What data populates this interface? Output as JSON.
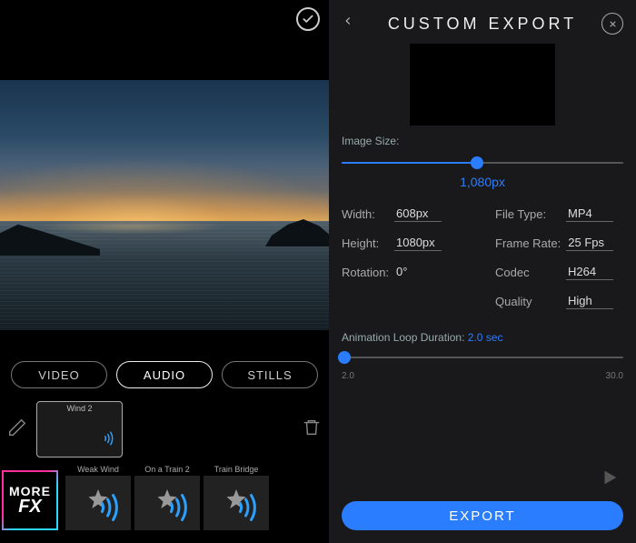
{
  "left": {
    "tabs": {
      "video": "VIDEO",
      "audio": "AUDIO",
      "stills": "STILLS"
    },
    "clip": {
      "label": "Wind 2"
    },
    "morefx": {
      "line1": "MORE",
      "line2": "FX"
    },
    "fx": [
      {
        "name": "Weak Wind"
      },
      {
        "name": "On a Train 2"
      },
      {
        "name": "Train Bridge"
      }
    ]
  },
  "right": {
    "title": "CUSTOM  EXPORT",
    "image_size_label": "Image Size:",
    "image_size_value": "1,080px",
    "image_size_pct": 48,
    "width_label": "Width:",
    "width_value": "608px",
    "height_label": "Height:",
    "height_value": "1080px",
    "rotation_label": "Rotation:",
    "rotation_value": "0°",
    "filetype_label": "File Type:",
    "filetype_value": "MP4",
    "framerate_label": "Frame Rate:",
    "framerate_value": "25 Fps",
    "codec_label": "Codec",
    "codec_value": "H264",
    "quality_label": "Quality",
    "quality_value": "High",
    "anim_label": "Animation Loop Duration:",
    "anim_value": "2.0 sec",
    "anim_min": "2.0",
    "anim_max": "30.0",
    "export_label": "EXPORT"
  }
}
